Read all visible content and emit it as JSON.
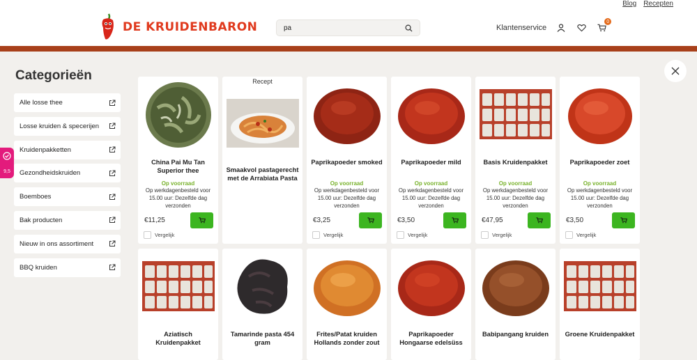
{
  "toplinks": {
    "blog": "Blog",
    "recepten": "Recepten"
  },
  "logo": {
    "text": "DE KRUIDENBARON"
  },
  "search": {
    "value": "pa"
  },
  "header": {
    "service": "Klantenservice",
    "cart_count": "0"
  },
  "sidebar": {
    "title": "Categorieën",
    "items": [
      {
        "label": "Alle losse thee"
      },
      {
        "label": "Losse kruiden & specerijen"
      },
      {
        "label": "Kruidenpakketten"
      },
      {
        "label": "Gezondheidskruiden"
      },
      {
        "label": "Boemboes"
      },
      {
        "label": "Bak producten"
      },
      {
        "label": "Nieuw in ons assortiment"
      },
      {
        "label": "BBQ kruiden"
      }
    ]
  },
  "review": {
    "score": "9,5"
  },
  "products": [
    {
      "name": "China Pai Mu Tan Superior thee",
      "stock": "Op voorraad",
      "delivery": "Op werkdagenbesteld voor 15.00 uur: Dezelfde dag verzonden",
      "price": "€11,25",
      "compare": "Vergelijk"
    },
    {
      "tag": "Recept",
      "name": "Smaakvol pastagerecht met de Arrabiata Pasta"
    },
    {
      "name": "Paprikapoeder smoked",
      "stock": "Op voorraad",
      "delivery": "Op werkdagenbesteld voor 15.00 uur: Dezelfde dag verzonden",
      "price": "€3,25",
      "compare": "Vergelijk"
    },
    {
      "name": "Paprikapoeder mild",
      "stock": "Op voorraad",
      "delivery": "Op werkdagenbesteld voor 15.00 uur: Dezelfde dag verzonden",
      "price": "€3,50",
      "compare": "Vergelijk"
    },
    {
      "name": "Basis Kruidenpakket",
      "stock": "Op voorraad",
      "delivery": "Op werkdagenbesteld voor 15.00 uur: Dezelfde dag verzonden",
      "price": "€47,95",
      "compare": "Vergelijk"
    },
    {
      "name": "Paprikapoeder zoet",
      "stock": "Op voorraad",
      "delivery": "Op werkdagenbesteld voor 15.00 uur: Dezelfde dag verzonden",
      "price": "€3,50",
      "compare": "Vergelijk"
    },
    {
      "name": "Aziatisch Kruidenpakket"
    },
    {
      "name": "Tamarinde pasta 454 gram"
    },
    {
      "name": "Frites/Patat kruiden Hollands zonder zout"
    },
    {
      "name": "Paprikapoeder Hongaarse edelsüss"
    },
    {
      "name": "Babipangang kruiden"
    },
    {
      "name": "Groene Kruidenpakket"
    }
  ],
  "colors": {
    "accent_green": "#3cb520",
    "brand_red": "#e03a1e",
    "brand_bar": "#a8401a",
    "stock_green": "#7ab32e"
  }
}
